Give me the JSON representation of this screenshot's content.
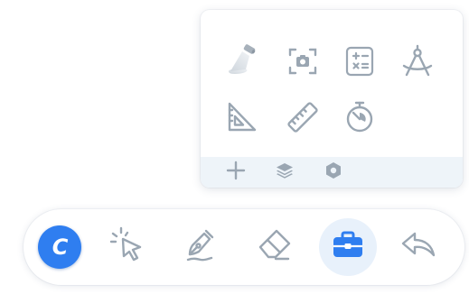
{
  "colors": {
    "icon_gray": "#9aa6b2",
    "accent_blue": "#2f7ef0",
    "active_bg": "#e8f1fb",
    "footer_bg": "#eef4f9"
  },
  "tool_panel": {
    "tools": [
      {
        "icon": "spotlight-icon"
      },
      {
        "icon": "screenshot-icon"
      },
      {
        "icon": "calculator-icon"
      },
      {
        "icon": "compass-icon"
      },
      {
        "icon": "set-square-icon"
      },
      {
        "icon": "ruler-icon"
      },
      {
        "icon": "stopwatch-icon"
      }
    ],
    "footer": [
      {
        "icon": "plus-icon"
      },
      {
        "icon": "layers-icon"
      },
      {
        "icon": "hexagon-icon"
      }
    ]
  },
  "toolbar": {
    "logo_letter": "C",
    "items": [
      {
        "icon": "logo-icon"
      },
      {
        "icon": "select-cursor-icon"
      },
      {
        "icon": "pen-icon"
      },
      {
        "icon": "eraser-icon"
      },
      {
        "icon": "toolbox-icon",
        "active": true
      },
      {
        "icon": "undo-icon"
      }
    ]
  }
}
